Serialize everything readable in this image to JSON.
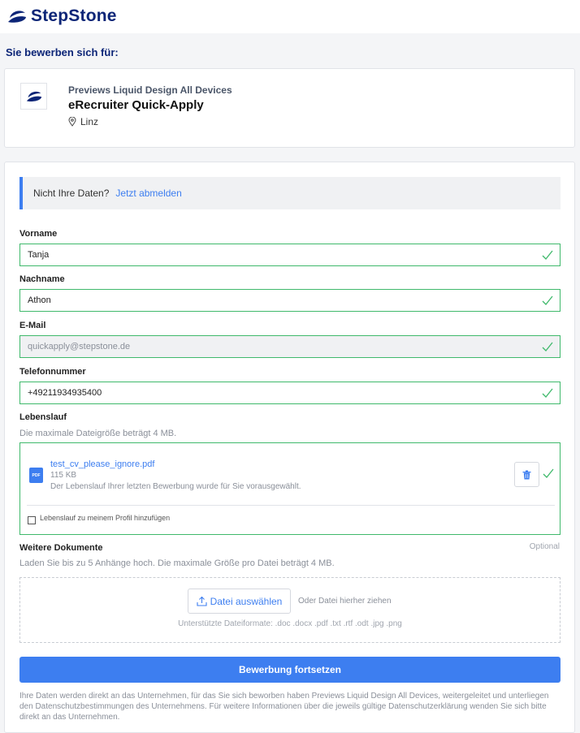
{
  "brand": {
    "name": "StepStone",
    "color": "#0c2577",
    "accent": "#3d7ef0",
    "success": "#3fb96b"
  },
  "page": {
    "section_title": "Sie bewerben sich für:"
  },
  "job": {
    "company": "Previews Liquid Design All Devices",
    "title": "eRecruiter Quick-Apply",
    "location": "Linz"
  },
  "notice": {
    "text": "Nicht Ihre Daten?",
    "link": "Jetzt abmelden"
  },
  "fields": {
    "first_name": {
      "label": "Vorname",
      "value": "Tanja"
    },
    "last_name": {
      "label": "Nachname",
      "value": "Athon"
    },
    "email": {
      "label": "E-Mail",
      "value": "quickapply@stepstone.de"
    },
    "phone": {
      "label": "Telefonnummer",
      "value": "+49211934935400"
    }
  },
  "cv": {
    "label": "Lebenslauf",
    "hint": "Die maximale Dateigröße beträgt 4 MB.",
    "file_type": "PDF",
    "file_name": "test_cv_please_ignore.pdf",
    "file_size": "115 KB",
    "note": "Der Lebenslauf Ihrer letzten Bewerbung wurde für Sie vorausgewählt.",
    "checkbox_label": "Lebenslauf zu meinem Profil hinzufügen"
  },
  "documents": {
    "label": "Weitere Dokumente",
    "optional": "Optional",
    "hint": "Laden Sie bis zu 5 Anhänge hoch. Die maximale Größe pro Datei beträgt 4 MB.",
    "button": "Datei auswählen",
    "drop_text": "Oder Datei hierher ziehen",
    "formats": "Unterstützte Dateiformate: .doc .docx .pdf .txt .rtf .odt .jpg .png"
  },
  "submit": {
    "label": "Bewerbung fortsetzen"
  },
  "footer": {
    "text": "Ihre Daten werden direkt an das Unternehmen, für das Sie sich beworben haben Previews Liquid Design All Devices, weitergeleitet und unterliegen den Datenschutzbestimmungen des Unternehmens. Für weitere Informationen über die jeweils gültige Datenschutzerklärung wenden Sie sich bitte direkt an das Unternehmen."
  }
}
